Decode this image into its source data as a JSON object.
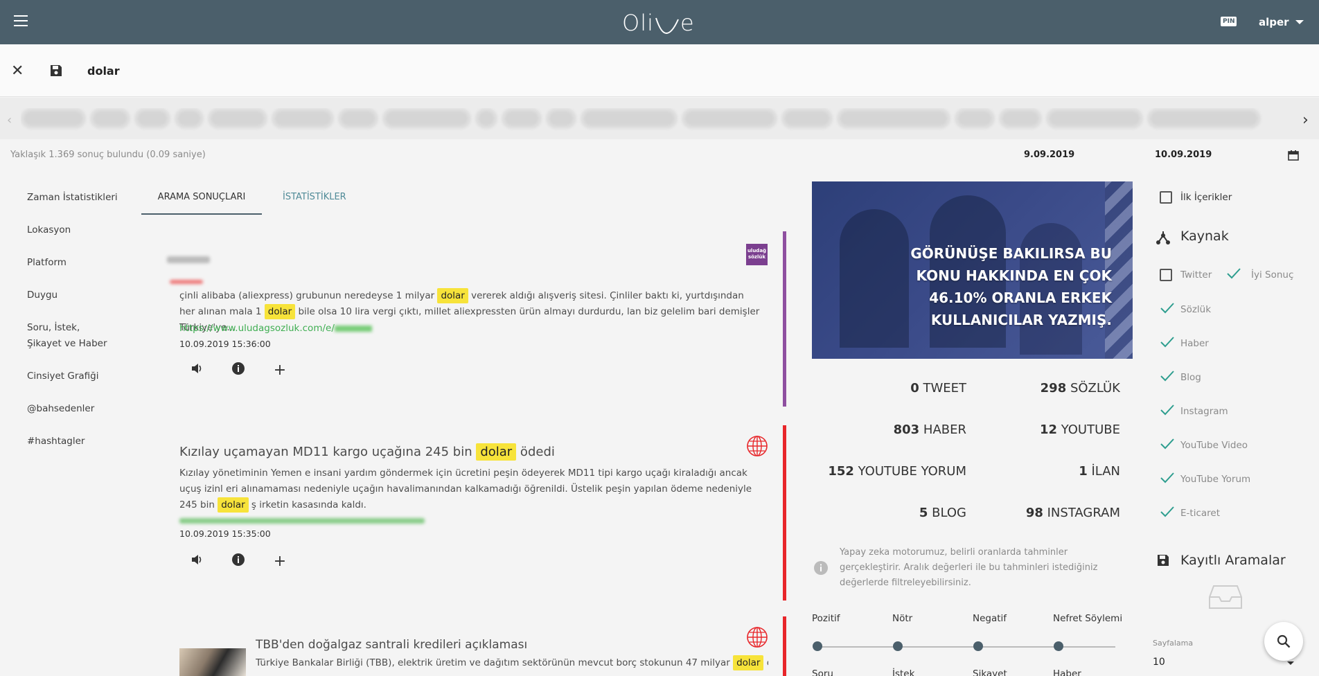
{
  "header": {
    "logo_text": "Oli",
    "logo_tail": "e",
    "pin_label": "PIN",
    "user_name": "alper"
  },
  "search": {
    "query": "dolar"
  },
  "info": {
    "result_count": "Yaklaşık 1.369 sonuç bulundu (0.09 saniye)",
    "date_start": "9.09.2019",
    "date_end": "10.09.2019"
  },
  "left_nav": {
    "items": [
      {
        "label": "Zaman İstatistikleri"
      },
      {
        "label": "Lokasyon"
      },
      {
        "label": "Platform"
      },
      {
        "label": "Duygu"
      },
      {
        "label": "Soru, İstek, Şikayet ve Haber"
      },
      {
        "label": "Cinsiyet Grafiği"
      },
      {
        "label": "@bahsedenler"
      },
      {
        "label": "#hashtagler"
      }
    ]
  },
  "tabs": [
    {
      "label": "ARAMA SONUÇLARI"
    },
    {
      "label": "İSTATİSTİKLER"
    }
  ],
  "results": [
    {
      "source_badge": "uludağ sözlük",
      "text_before": "çinli alibaba (aliexpress) grubunun neredeyse 1 milyar ",
      "highlight_1": "dolar",
      "text_mid": " vererek aldığı alışveriş sitesi. Çinliler baktı ki, yurtdışından her alınan mala 1 ",
      "highlight_2": "dolar",
      "text_after": " bile olsa 10 lira vergi çıktı, millet aliexpressten ürün almayı durdurdu, lan biz gelelim bari demişler Türkiye'ye...",
      "url": "https://www.uludagsozluk.com/e/",
      "date": "10.09.2019 15:36:00",
      "accent": "#8e4fa0"
    },
    {
      "title_before": "Kızılay uçamayan MD11 kargo uçağına 245 bin ",
      "title_highlight": "dolar",
      "title_after": " ödedi",
      "text_before": "Kızılay yönetiminin Yemen e insani yardım göndermek için ücretini peşin ödeyerek MD11 tipi kargo uçağı kiraladığı ancak uçuş izinl eri alınamaması nedeniyle uçağın havalimanından kalkamadığı öğrenildi. Üstelik peşin yapılan ödeme nedeniyle 245 bin ",
      "highlight_1": "dolar",
      "text_after": " ş irketin kasasında kaldı.",
      "date": "10.09.2019 15:35:00",
      "accent": "#e8262a"
    },
    {
      "title": "TBB'den doğalgaz santrali kredileri açıklaması",
      "text_before": "Türkiye Bankalar Birliği (TBB), elektrik üretim ve dağıtım sektörünün mevcut borç stokunun 47 milyar ",
      "highlight_1": "dolar",
      "text_after": " civar",
      "accent": "#e8262a"
    }
  ],
  "insight": {
    "text": "GÖRÜNÜŞE BAKILIRSA BU KONU HAKKINDA EN ÇOK 46.10% ORANLA ERKEK KULLANICILAR YAZMIŞ."
  },
  "stats": [
    {
      "count": "0",
      "label": "TWEET"
    },
    {
      "count": "298",
      "label": "SÖZLÜK"
    },
    {
      "count": "803",
      "label": "HABER"
    },
    {
      "count": "12",
      "label": "YOUTUBE"
    },
    {
      "count": "152",
      "label": "YOUTUBE YORUM"
    },
    {
      "count": "1",
      "label": "İLAN"
    },
    {
      "count": "5",
      "label": "BLOG"
    },
    {
      "count": "98",
      "label": "INSTAGRAM"
    }
  ],
  "ai_note": "Yapay zeka motorumuz, belirli oranlarda tahminler gerçekleştirir. Aralık değerleri ile bu tahminleri istediğiniz değerlerde filtreleyebilirsiniz.",
  "sentiment": {
    "labels": [
      "Pozitif",
      "Nötr",
      "Negatif",
      "Nefret Söylemi"
    ],
    "labels2": [
      "Soru",
      "İstek",
      "Şikayet",
      "Haber"
    ]
  },
  "filters": {
    "first_contents": "İlk İçerikler",
    "source_title": "Kaynak",
    "twitter": "Twitter",
    "good_result": "İyi Sonuç",
    "sources": [
      "Sözlük",
      "Haber",
      "Blog",
      "Instagram",
      "YouTube Video",
      "YouTube Yorum",
      "E-ticaret"
    ],
    "saved_title": "Kayıtlı Aramalar"
  },
  "pagination": {
    "label": "Sayfalama",
    "value": "10"
  },
  "colors": {
    "topbar": "#4b5f6b",
    "highlight": "#f7e33a",
    "link": "#3fae52",
    "check": "#2e9e8f"
  }
}
